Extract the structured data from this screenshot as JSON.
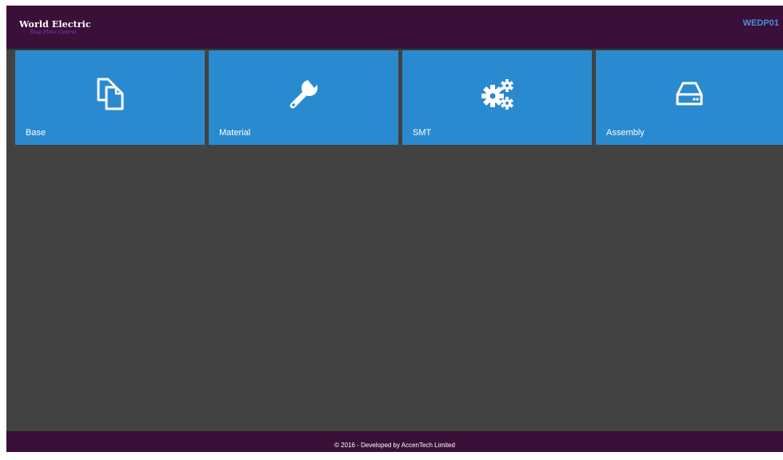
{
  "header": {
    "brand_name": "World Electric",
    "brand_subtitle": "Shop Floor Control",
    "station_code": "WEDP01"
  },
  "tiles": [
    {
      "label": "Base",
      "icon": "copy-documents-icon"
    },
    {
      "label": "Material",
      "icon": "wrench-icon"
    },
    {
      "label": "SMT",
      "icon": "gears-icon"
    },
    {
      "label": "Assembly",
      "icon": "hard-drive-icon"
    }
  ],
  "footer": {
    "text": "© 2016 - Developed by AccenTech Limited"
  },
  "colors": {
    "header_bg": "#3a0f38",
    "body_bg": "#424242",
    "tile_bg": "#2a8ad0",
    "station_text": "#4a8fe0",
    "subtitle_text": "#8a3fd0"
  }
}
